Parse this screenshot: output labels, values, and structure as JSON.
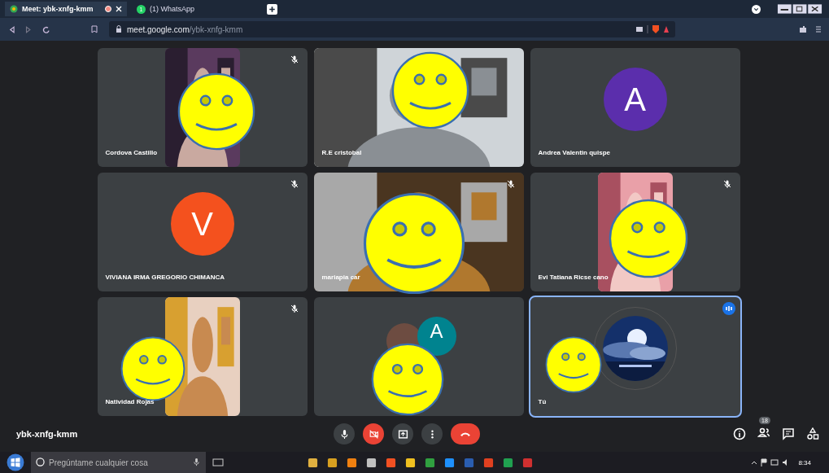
{
  "browser": {
    "tabs": [
      {
        "title": "Meet: ybk-xnfg-kmm",
        "selected": true,
        "recording": true
      },
      {
        "title": "(1) WhatsApp",
        "selected": false,
        "badge": "1"
      }
    ],
    "address": {
      "host": "meet.google.com",
      "path": "/ybk-xnfg-kmm"
    }
  },
  "tiles": [
    {
      "name": "Cordova Castillo",
      "kind": "portrait",
      "muted": true,
      "smiley": true
    },
    {
      "name": "R.E cristobal",
      "kind": "video",
      "muted": false,
      "smiley": true
    },
    {
      "name": "Andrea Valentin quispe",
      "kind": "avatar",
      "muted": false,
      "smiley": false,
      "letter": "A",
      "color": "#5b2eac"
    },
    {
      "name": "VIVIANA IRMA GREGORIO CHIMANCA",
      "kind": "avatar",
      "muted": true,
      "smiley": false,
      "letter": "V",
      "color": "#f4511e"
    },
    {
      "name": "mariapia car",
      "kind": "video",
      "muted": true,
      "smiley": true
    },
    {
      "name": "Evi Tatiana Ricse cano",
      "kind": "portrait",
      "muted": true,
      "smiley": true
    },
    {
      "name": "Natividad Rojas",
      "kind": "portrait",
      "muted": true,
      "smiley": true
    },
    {
      "kind": "group",
      "muted": false,
      "smiley": true,
      "letter": "A",
      "color": "#00838f"
    },
    {
      "name": "Tú",
      "kind": "self",
      "muted": false,
      "smiley": true,
      "speaking": true
    }
  ],
  "meeting": {
    "code": "ybk-xnfg-kmm",
    "participants": "18"
  },
  "taskbar": {
    "search": {
      "placeholder": "Pregúntame cualquier cosa"
    },
    "time": "8:34"
  }
}
